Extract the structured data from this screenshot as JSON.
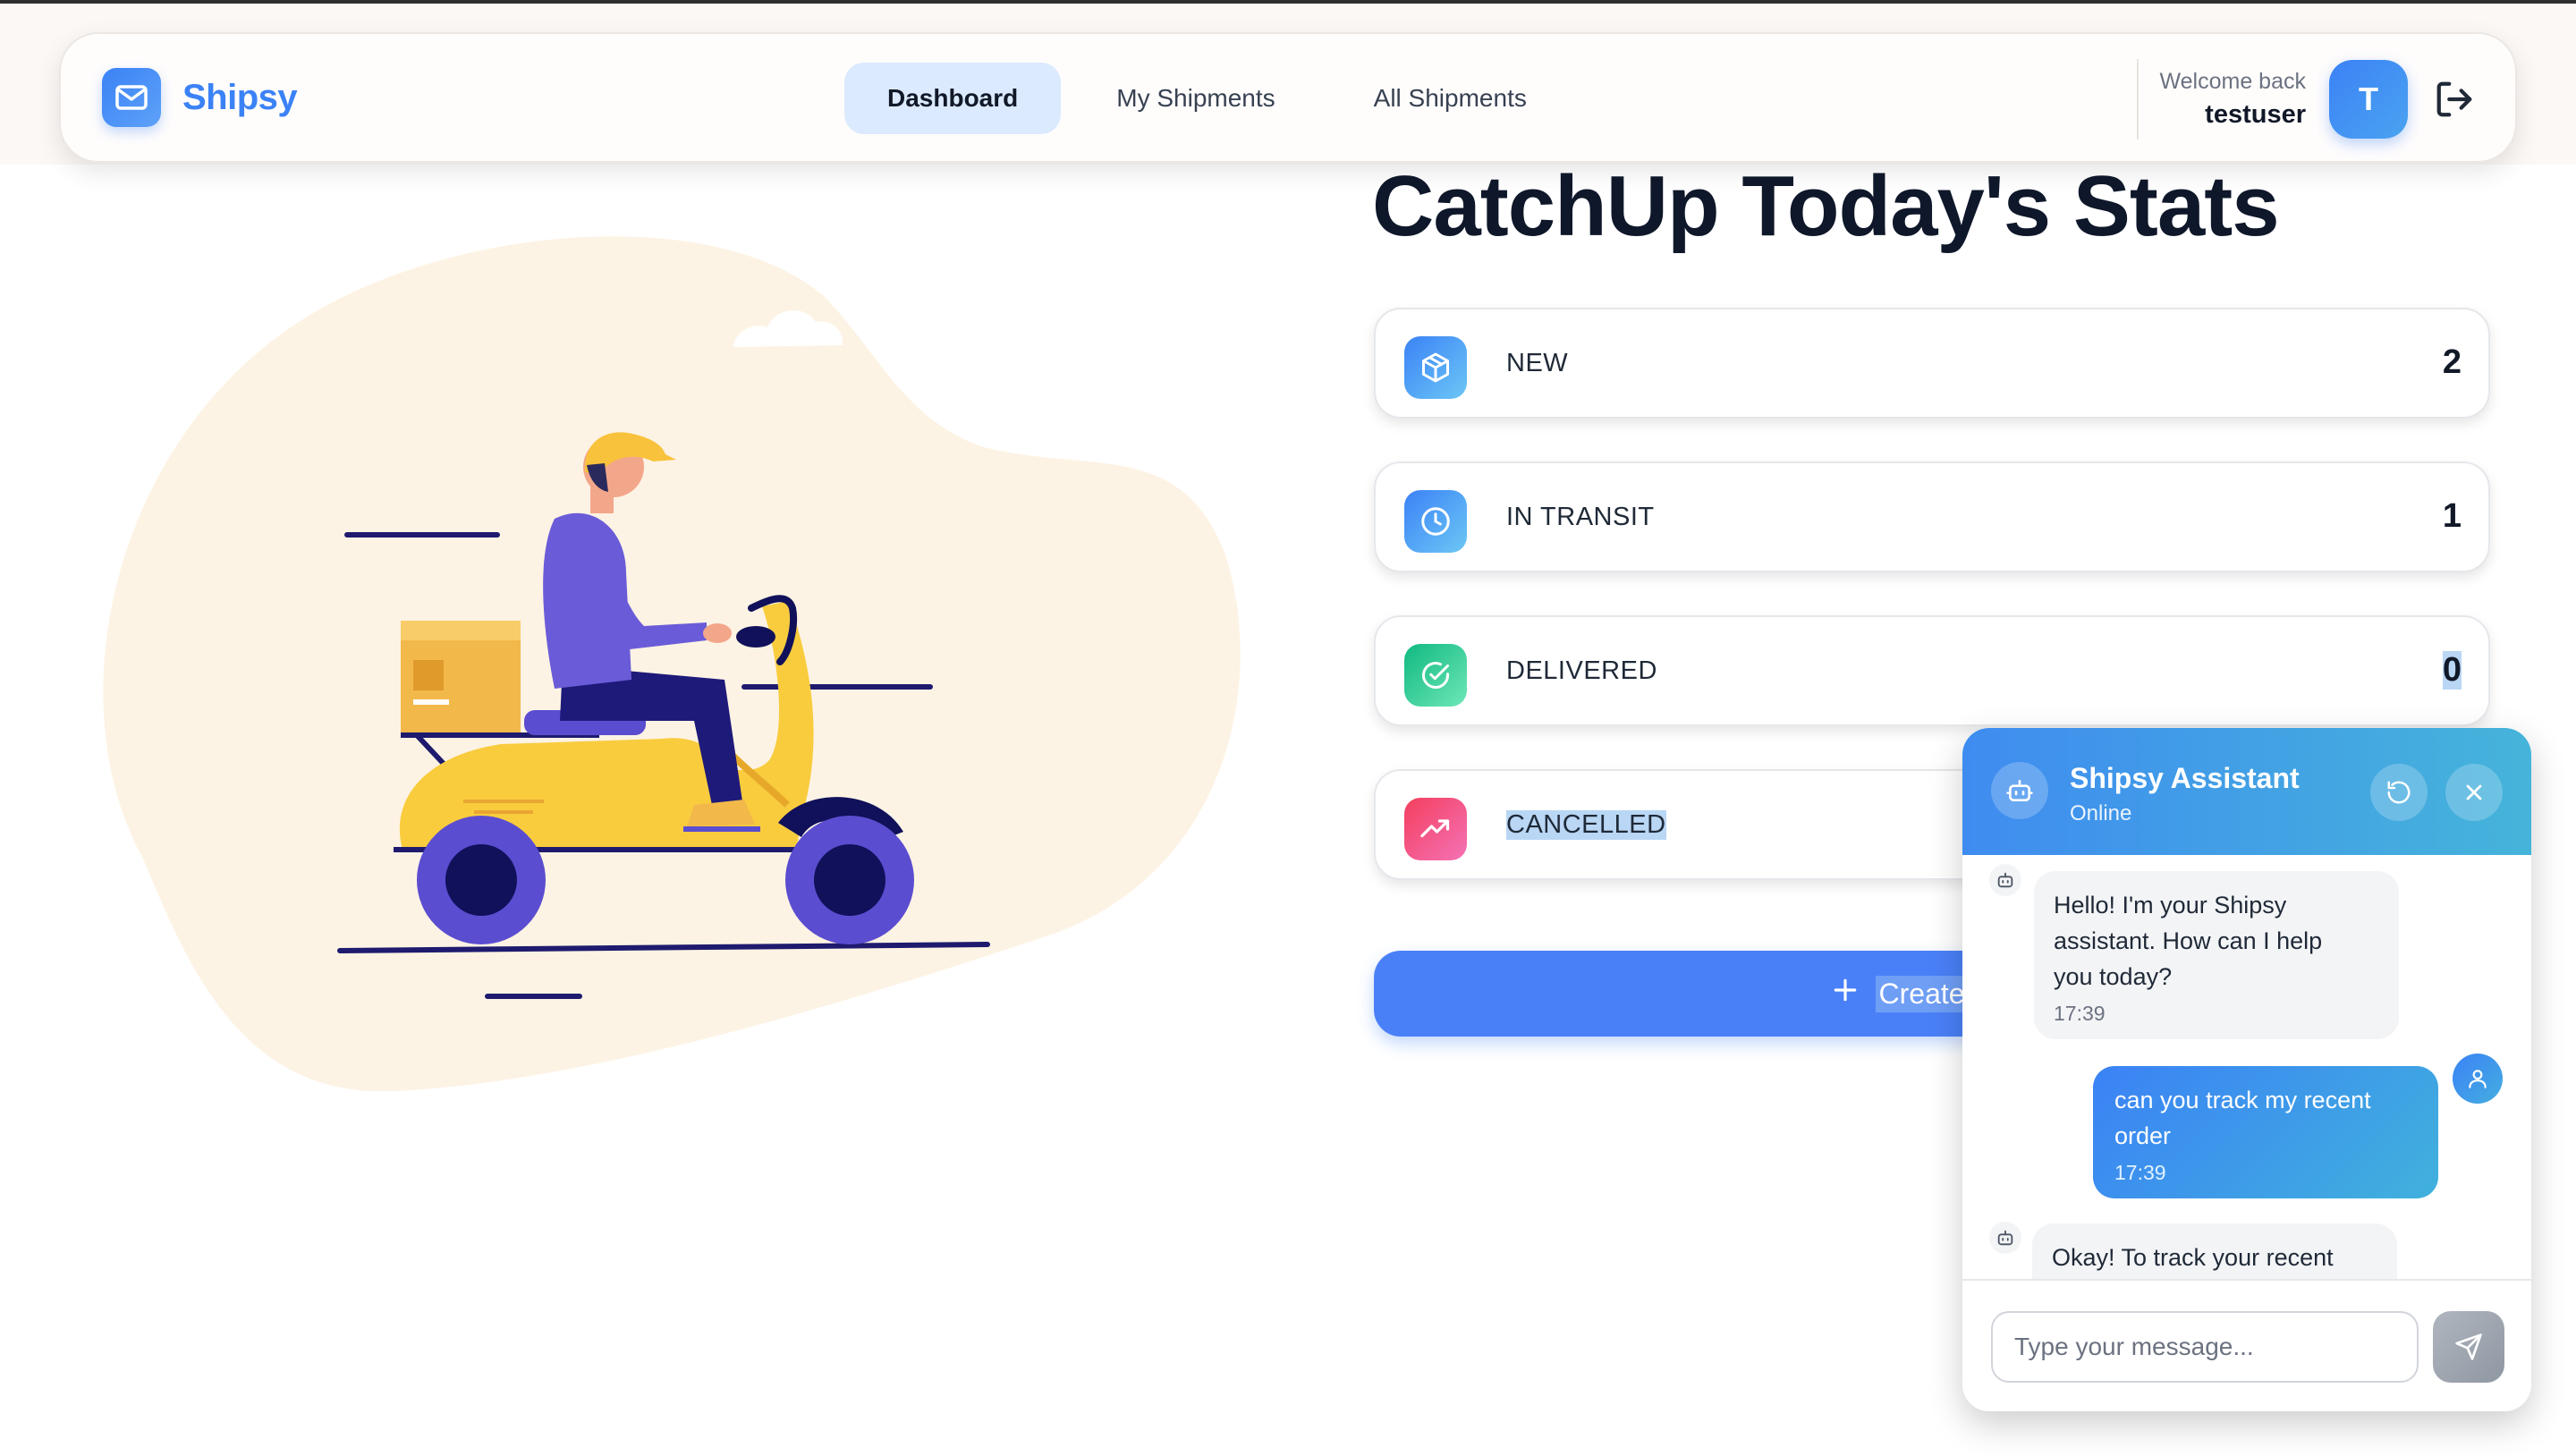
{
  "header": {
    "brand": "Shipsy",
    "nav": [
      "Dashboard",
      "My Shipments",
      "All Shipments"
    ],
    "active_tab": "Dashboard",
    "welcome": "Welcome back",
    "username": "testuser",
    "avatar_initial": "T"
  },
  "icons": {
    "brand_logo": "mail-icon",
    "logout": "logout-icon",
    "new": "box-icon",
    "in_transit": "clock-icon",
    "delivered": "check-circle-icon",
    "cancelled": "trending-up-icon",
    "create": "plus-icon",
    "assistant": "bot-icon",
    "reset": "refresh-icon",
    "close": "close-icon",
    "user": "user-icon",
    "send": "send-icon"
  },
  "main": {
    "title": "CatchUp Today's Stats",
    "stats": [
      {
        "label": "NEW",
        "value": "2",
        "color": "#60a5fa"
      },
      {
        "label": "IN TRANSIT",
        "value": "1",
        "color": "#60a5fa"
      },
      {
        "label": "DELIVERED",
        "value": "0",
        "color": "#34d399"
      },
      {
        "label": "CANCELLED",
        "value": "",
        "color": "#f43f5e"
      }
    ],
    "create_label": "Create New"
  },
  "chat": {
    "title": "Shipsy Assistant",
    "status": "Online",
    "messages": [
      {
        "from": "bot",
        "lines": [
          "Hello! I'm your Shipsy",
          "assistant. How can I help",
          "you today?"
        ],
        "time": "17:39"
      },
      {
        "from": "user",
        "lines": [
          "can you track my recent",
          "order"
        ],
        "time": "17:39"
      },
      {
        "from": "bot",
        "lines": [
          "Okay! To track your recent"
        ]
      }
    ],
    "input_placeholder": "Type your message..."
  },
  "colors": {
    "accent": "#3b82f6",
    "active_tab_bg": "#dbeafe",
    "chat_gradient_start": "#3f8cf0",
    "chat_gradient_end": "#45b4da",
    "blob": "#fdf3e4",
    "scooter": "#fcd34d",
    "rider_shirt": "#6a5cd8"
  }
}
